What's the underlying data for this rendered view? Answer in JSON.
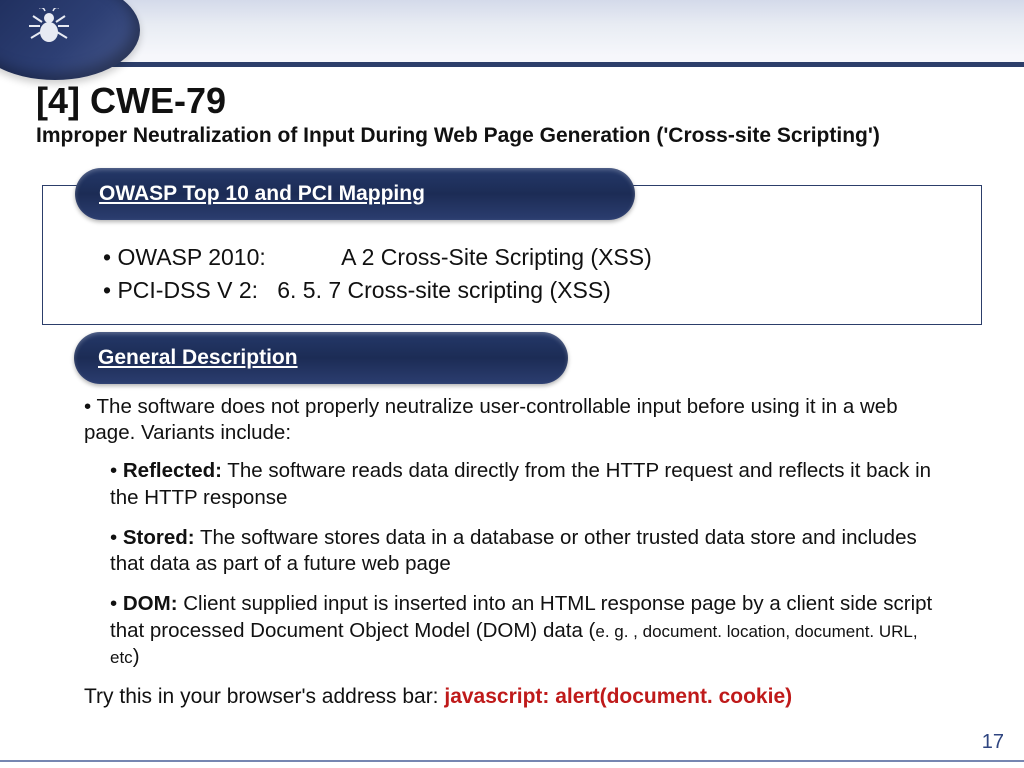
{
  "header": {
    "title": "[4] CWE-79",
    "subtitle": "Improper Neutralization of Input During Web Page Generation ('Cross-site Scripting')"
  },
  "sections": {
    "mapping": {
      "label": "OWASP Top 10 and PCI Mapping",
      "items": [
        "OWASP 2010:            A 2 Cross-Site Scripting (XSS)",
        "PCI-DSS V 2:   6. 5. 7 Cross-site scripting (XSS)"
      ]
    },
    "description": {
      "label": "General Description",
      "intro": "The software does not properly neutralize user-controllable input before using it in a web page. Variants include:",
      "variants": [
        {
          "name": "Reflected:",
          "text": " The software reads data directly from the HTTP request and reflects it back in the HTTP response"
        },
        {
          "name": "Stored:",
          "text": " The software stores data in a database or other trusted data store and includes that data as part of a future web page"
        },
        {
          "name": "DOM:",
          "text": " Client supplied input is inserted into an HTML response page by a client side script that processed Document Object Model (DOM) data (",
          "eg": "e. g. , document. location, document. URL, etc",
          "close": ")"
        }
      ],
      "try_label": "Try this in your browser's address bar: ",
      "try_code": "javascript: alert(document. cookie)"
    }
  },
  "page_number": "17"
}
